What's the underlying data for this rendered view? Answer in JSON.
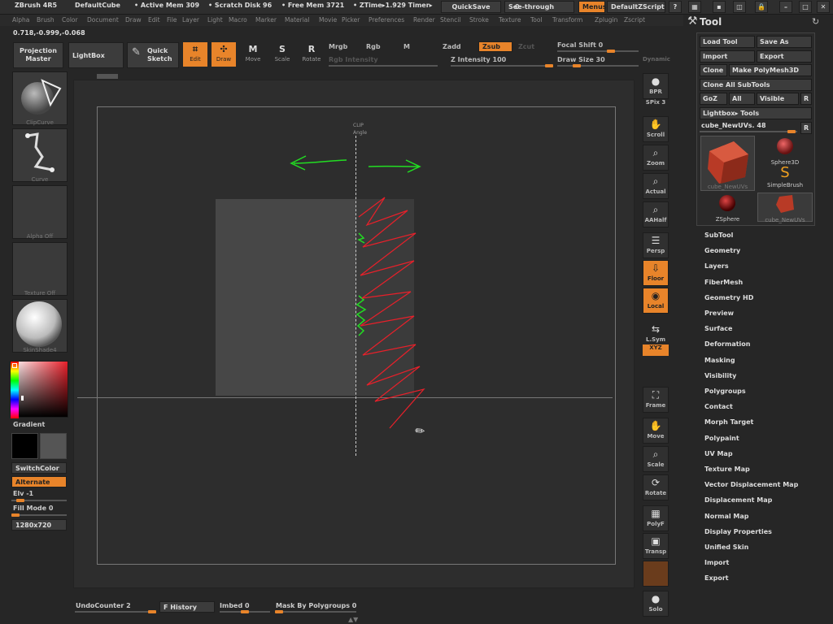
{
  "titlebar": {
    "app": "ZBrush 4R5",
    "doc": "DefaultCube",
    "active_mem": "• Active Mem 309",
    "scratch": "• Scratch Disk 96",
    "free_mem": "• Free Mem 3721",
    "ztime": "• ZTime▸1.929 Timer▸",
    "quicksave": "QuickSave",
    "seethrough": "See-through",
    "seethrough_value": "0",
    "menus": "Menus",
    "script": "DefaultZScript"
  },
  "menus": [
    "Alpha",
    "Brush",
    "Color",
    "Document",
    "Draw",
    "Edit",
    "File",
    "Layer",
    "Light",
    "Macro",
    "Marker",
    "Material",
    "Movie",
    "Picker",
    "Preferences",
    "Render",
    "Stencil",
    "Stroke",
    "Texture",
    "Tool",
    "Transform",
    "Zplugin",
    "Zscript"
  ],
  "coords": "0.718,-0.999,-0.068",
  "top_toolbar": {
    "projection_master": "Projection Master",
    "lightbox": "LightBox",
    "quick_sketch": "Quick Sketch",
    "edit": "Edit",
    "draw": "Draw",
    "move": "Move",
    "scale": "Scale",
    "rotate": "Rotate",
    "mrgb": "Mrgb",
    "rgb": "Rgb",
    "m": "M",
    "rgb_intensity": "Rgb Intensity",
    "zadd": "Zadd",
    "zsub": "Zsub",
    "zcut": "Zcut",
    "z_intensity": "Z Intensity 100",
    "focal_shift": "Focal Shift 0",
    "draw_size": "Draw Size 30",
    "dynamic": "Dynamic"
  },
  "left_shelf": {
    "brush_cap": "ClipCurve",
    "stroke_cap": "Curve",
    "alpha_cap": "Alpha Off",
    "texture_cap": "Texture Off",
    "material_cap": "SkinShade4",
    "gradient": "Gradient",
    "switchcolor": "SwitchColor",
    "alternate": "Alternate",
    "elv": "Elv -1",
    "fill_mode": "Fill Mode 0",
    "resolution": "1280x720"
  },
  "canvas": {
    "clip_label": "CLIP",
    "angle_label": "Angle"
  },
  "right_shelf": [
    {
      "icon": "bpr",
      "label": "BPR"
    },
    {
      "icon": "spix",
      "label": "SPix 3"
    },
    {
      "icon": "hand",
      "label": "Scroll"
    },
    {
      "icon": "zoom",
      "label": "Zoom"
    },
    {
      "icon": "actual",
      "label": "Actual"
    },
    {
      "icon": "aahalf",
      "label": "AAHalf"
    },
    {
      "icon": "persp",
      "label": "Persp"
    },
    {
      "icon": "floor",
      "label": "Floor"
    },
    {
      "icon": "local",
      "label": "Local"
    },
    {
      "icon": "lsym",
      "label": "L.Sym"
    },
    {
      "icon": "xyz",
      "label": "XYZ"
    },
    {
      "icon": "frame",
      "label": "Frame"
    },
    {
      "icon": "move",
      "label": "Move"
    },
    {
      "icon": "scale",
      "label": "Scale"
    },
    {
      "icon": "rotate",
      "label": "Rotate"
    },
    {
      "icon": "polyf",
      "label": "PolyF"
    },
    {
      "icon": "transp",
      "label": "Transp"
    },
    {
      "icon": "solo",
      "label": "Solo"
    }
  ],
  "tool": {
    "title": "Tool",
    "load_tool": "Load Tool",
    "save_as": "Save As",
    "import": "Import",
    "export": "Export",
    "clone": "Clone",
    "make_polymesh": "Make PolyMesh3D",
    "clone_all": "Clone All SubTools",
    "goz": "GoZ",
    "all": "All",
    "visible": "Visible",
    "r": "R",
    "lightbox_tools": "Lightbox▸ Tools",
    "current_tool": "cube_NewUVs. 48",
    "thumbs": [
      {
        "name": "cube_NewUVs"
      },
      {
        "name": "Sphere3D"
      },
      {
        "name": "SimpleBrush"
      },
      {
        "name": "ZSphere"
      },
      {
        "name": "cube_NewUVs"
      }
    ],
    "subpalettes": [
      "SubTool",
      "Geometry",
      "Layers",
      "FiberMesh",
      "Geometry HD",
      "Preview",
      "Surface",
      "Deformation",
      "Masking",
      "Visibility",
      "Polygroups",
      "Contact",
      "Morph Target",
      "Polypaint",
      "UV Map",
      "Texture Map",
      "Vector Displacement Map",
      "Displacement Map",
      "Normal Map",
      "Display Properties",
      "Unified Skin",
      "Import",
      "Export"
    ]
  },
  "bottom": {
    "undo_counter": "UndoCounter 2",
    "history": "F History",
    "imbed": "Imbed",
    "imbed_value": "0",
    "mask_by_polygroups": "Mask By Polygroups",
    "mask_value": "0"
  },
  "colors": {
    "accent": "#e8842a",
    "annotation_red": "#e8202a",
    "annotation_green": "#22dd22"
  }
}
